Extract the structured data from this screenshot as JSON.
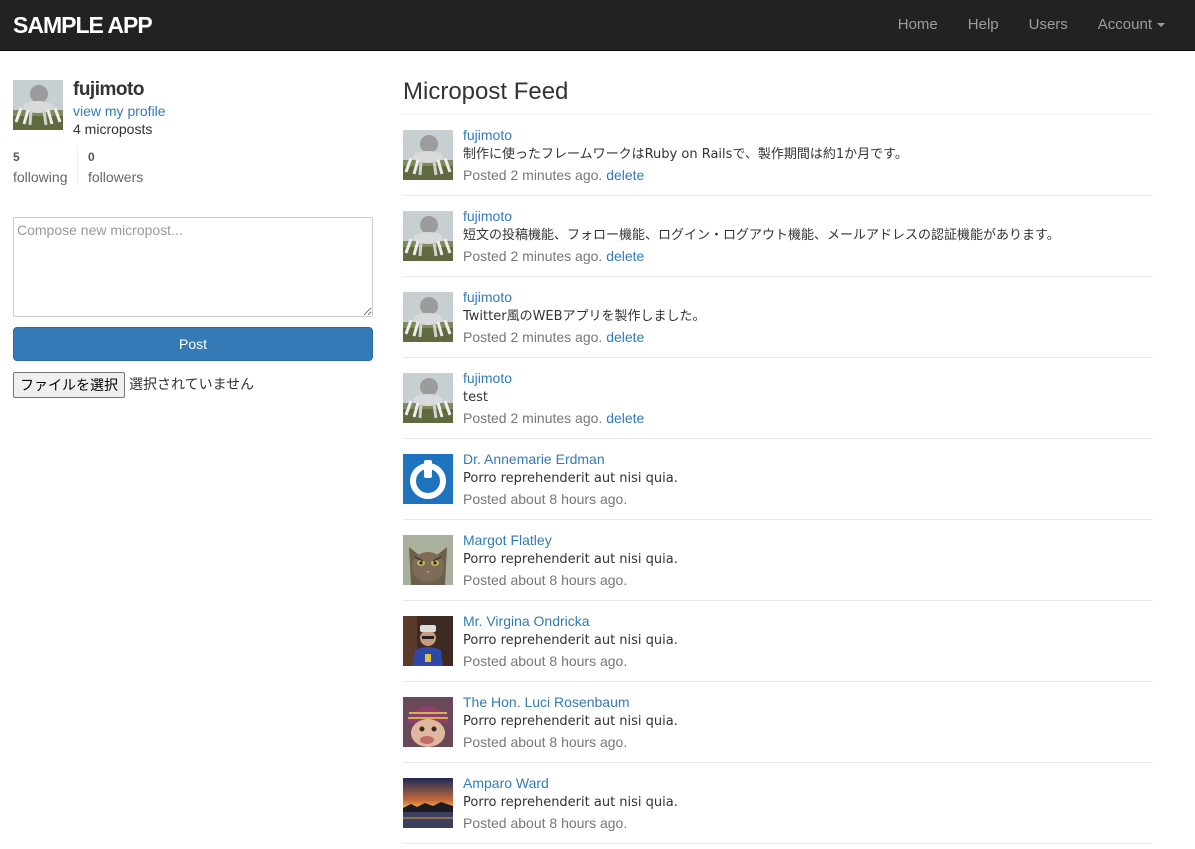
{
  "navbar": {
    "logo": "SAMPLE APP",
    "links": [
      "Home",
      "Help",
      "Users",
      "Account"
    ]
  },
  "sidebar": {
    "user_name": "fujimoto",
    "view_profile": "view my profile",
    "micropost_count": "4 microposts",
    "following_count": "5",
    "following_label": "following",
    "followers_count": "0",
    "followers_label": "followers",
    "compose_placeholder": "Compose new micropost...",
    "post_button": "Post",
    "file_button": "ファイルを選択",
    "file_status": "選択されていません"
  },
  "feed": {
    "title": "Micropost Feed",
    "posts": [
      {
        "user": "fujimoto",
        "content": "制作に使ったフレームワークはRuby on Railsで、製作期間は約1か月です。",
        "time": "Posted 2 minutes ago.",
        "delete": "delete",
        "avatar": "robot-avatar"
      },
      {
        "user": "fujimoto",
        "content": "短文の投稿機能、フォロー機能、ログイン・ログアウト機能、メールアドレスの認証機能があります。",
        "time": "Posted 2 minutes ago.",
        "delete": "delete",
        "avatar": "robot-avatar"
      },
      {
        "user": "fujimoto",
        "content": "Twitter風のWEBアプリを製作しました。",
        "time": "Posted 2 minutes ago.",
        "delete": "delete",
        "avatar": "robot-avatar"
      },
      {
        "user": "fujimoto",
        "content": "test",
        "time": "Posted 2 minutes ago.",
        "delete": "delete",
        "avatar": "robot-avatar"
      },
      {
        "user": "Dr. Annemarie Erdman",
        "content": "Porro reprehenderit aut nisi quia.",
        "time": "Posted about 8 hours ago.",
        "avatar": "gravatar-logo-avatar"
      },
      {
        "user": "Margot Flatley",
        "content": "Porro reprehenderit aut nisi quia.",
        "time": "Posted about 8 hours ago.",
        "avatar": "cat-avatar"
      },
      {
        "user": "Mr. Virgina Ondricka",
        "content": "Porro reprehenderit aut nisi quia.",
        "time": "Posted about 8 hours ago.",
        "avatar": "person-avatar"
      },
      {
        "user": "The Hon. Luci Rosenbaum",
        "content": "Porro reprehenderit aut nisi quia.",
        "time": "Posted about 8 hours ago.",
        "avatar": "child-avatar"
      },
      {
        "user": "Amparo Ward",
        "content": "Porro reprehenderit aut nisi quia.",
        "time": "Posted about 8 hours ago.",
        "avatar": "sunset-avatar"
      }
    ]
  }
}
